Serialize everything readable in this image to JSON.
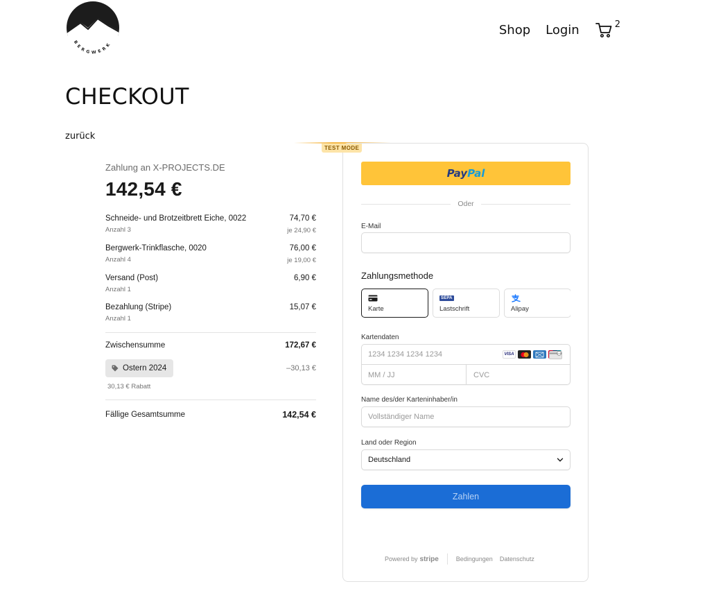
{
  "header": {
    "logo_text": "BERGWERK",
    "nav": {
      "shop": "Shop",
      "login": "Login",
      "cart_count": "2"
    }
  },
  "page": {
    "title": "CHECKOUT",
    "back": "zurück"
  },
  "summary": {
    "pay_to": "Zahlung an X-PROJECTS.DE",
    "total_big": "142,54 €",
    "items": [
      {
        "name": "Schneide- und Brotzeitbrett Eiche, 0022",
        "qty": "Anzahl 3",
        "price": "74,70 €",
        "unit": "je 24,90 €"
      },
      {
        "name": "Bergwerk-Trinkflasche, 0020",
        "qty": "Anzahl 4",
        "price": "76,00 €",
        "unit": "je 19,00 €"
      },
      {
        "name": "Versand (Post)",
        "qty": "Anzahl 1",
        "price": "6,90 €",
        "unit": ""
      },
      {
        "name": "Bezahlung (Stripe)",
        "qty": "Anzahl 1",
        "price": "15,07 €",
        "unit": ""
      }
    ],
    "subtotal_label": "Zwischensumme",
    "subtotal_value": "172,67 €",
    "coupon": "Ostern 2024",
    "discount_amount": "–30,13 €",
    "discount_note": "30,13 € Rabatt",
    "total_label": "Fällige Gesamtsumme",
    "total_value": "142,54 €"
  },
  "payment": {
    "test_mode": "TEST MODE",
    "paypal_a": "Pay",
    "paypal_b": "Pal",
    "or": "Oder",
    "email_label": "E-Mail",
    "email_value": "",
    "method_heading": "Zahlungsmethode",
    "methods": [
      {
        "label": "Karte",
        "icon": "card-icon"
      },
      {
        "label": "Lastschrift",
        "icon": "sepa-icon",
        "badge": "SEPA"
      },
      {
        "label": "Alipay",
        "icon": "alipay-icon"
      }
    ],
    "card_label": "Kartendaten",
    "card_placeholder": "1234 1234 1234 1234",
    "card_brands": [
      "VISA",
      "Mastercard",
      "American Express",
      "UnionPay"
    ],
    "exp_placeholder": "MM / JJ",
    "cvc_placeholder": "CVC",
    "name_label": "Name des/der Karteninhaber/in",
    "name_placeholder": "Vollständiger Name",
    "country_label": "Land oder Region",
    "country_value": "Deutschland",
    "pay_button": "Zahlen",
    "footer": {
      "powered": "Powered by",
      "stripe": "stripe",
      "terms": "Bedingungen",
      "privacy": "Datenschutz"
    }
  },
  "colors": {
    "paypal_yellow": "#ffc439",
    "pay_button": "#1b6dd6",
    "test_badge": "#fde4a8"
  }
}
